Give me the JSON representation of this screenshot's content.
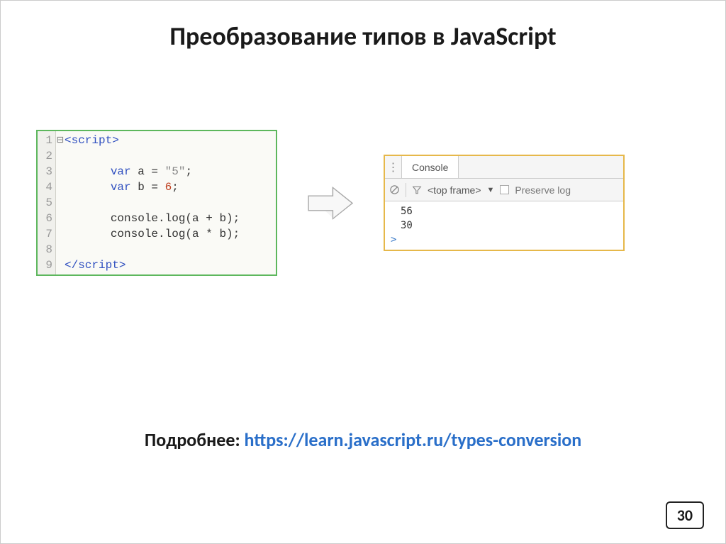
{
  "title": "Преобразование типов в JavaScript",
  "code": {
    "lines": [
      "1",
      "2",
      "3",
      "4",
      "5",
      "6",
      "7",
      "8",
      "9"
    ],
    "l1_tag_open": "<script>",
    "l3_kw": "var",
    "l3_rest": " a = ",
    "l3_str": "\"5\"",
    "l3_semi": ";",
    "l4_kw": "var",
    "l4_rest": " b = ",
    "l4_num": "6",
    "l4_semi": ";",
    "l6": "console.log(a + b);",
    "l7": "console.log(a * b);",
    "l9_tag_close": "</script>"
  },
  "console": {
    "tab": "Console",
    "frame": "<top frame>",
    "preserve": "Preserve log",
    "out1": "56",
    "out2": "30",
    "prompt": ">"
  },
  "footer": {
    "label": "Подробнее: ",
    "link_text": "https://learn.javascript.ru/types-conversion",
    "link_href": "https://learn.javascript.ru/types-conversion"
  },
  "page_number": "30"
}
